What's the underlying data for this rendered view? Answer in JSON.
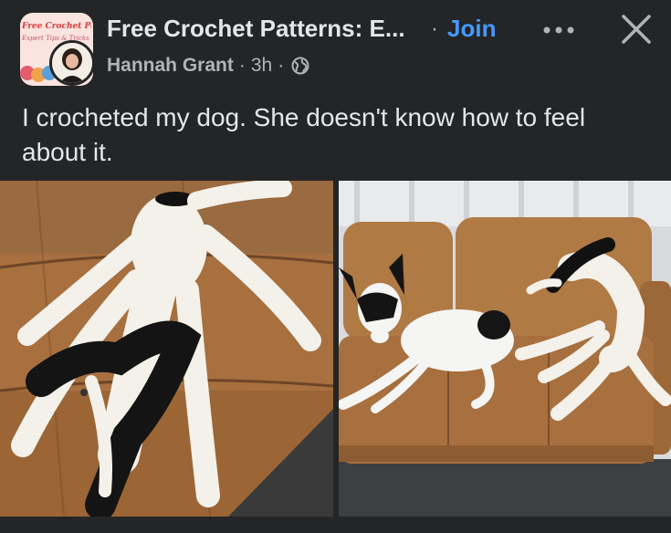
{
  "header": {
    "group_avatar_title": "Free Crochet Patterns",
    "group_avatar_subtitle": "Expert Tips & Tricks",
    "group_name": "Free Crochet Patterns: E...",
    "separator": "·",
    "join_label": "Join",
    "author_name": "Hannah Grant",
    "time_ago": "3h",
    "meta_separator": "·",
    "audience_icon": "globe-icon",
    "more_icon": "more-options-icon",
    "close_icon": "close-icon"
  },
  "post": {
    "text": "I crocheted my dog. She doesn't know how to feel about it."
  },
  "photos": [
    {
      "subject": "crocheted-dog-plush-on-sofa"
    },
    {
      "subject": "dog-beside-crocheted-plush-on-sofa"
    }
  ],
  "colors": {
    "background": "#242526",
    "primary_text": "#e4e6eb",
    "secondary_text": "#b0b3b8",
    "join_blue": "#4599ff",
    "sofa_leather": "#a8703f"
  }
}
